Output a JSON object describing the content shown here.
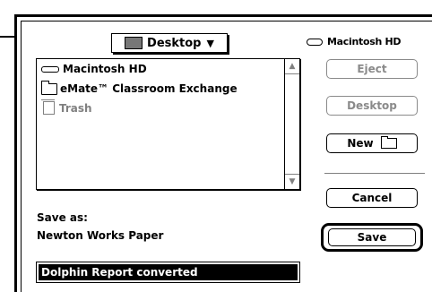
{
  "popup": {
    "folder_name": "Desktop"
  },
  "volume": {
    "name": "Macintosh HD"
  },
  "file_list": {
    "items": [
      {
        "label": "Macintosh HD",
        "icon": "disk-icon",
        "dim": false
      },
      {
        "label": "eMate™ Classroom Exchange",
        "icon": "folder-icon",
        "dim": false
      },
      {
        "label": "Trash",
        "icon": "trash-icon",
        "dim": true
      }
    ]
  },
  "buttons": {
    "eject": "Eject",
    "desktop": "Desktop",
    "new": "New",
    "cancel": "Cancel",
    "save": "Save"
  },
  "save_as": {
    "label": "Save as:",
    "format": "Newton Works Paper",
    "filename": "Dolphin Report converted"
  },
  "colors": {
    "foreground": "#000000",
    "background": "#ffffff",
    "disabled": "#808080"
  }
}
